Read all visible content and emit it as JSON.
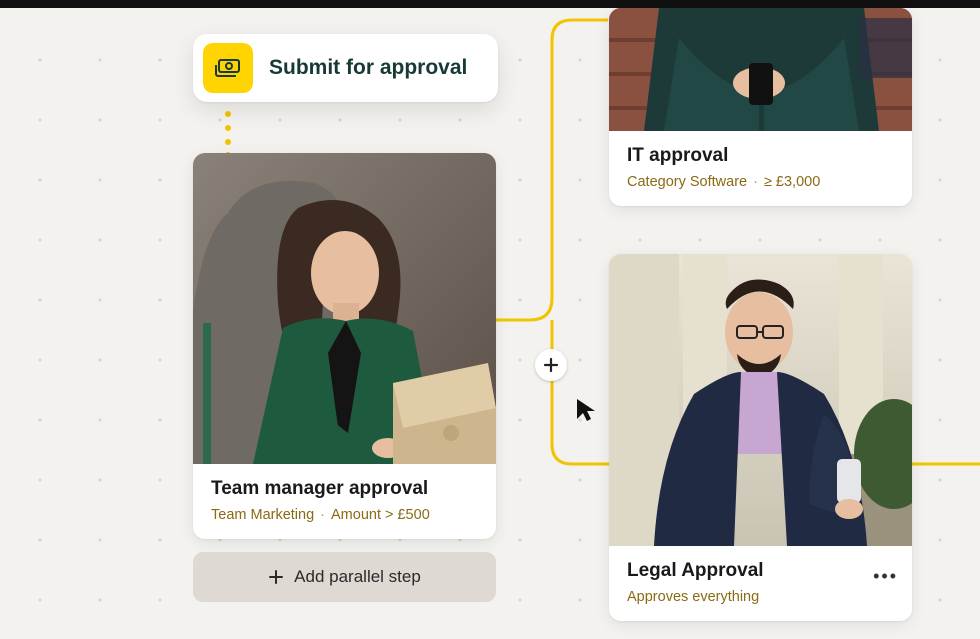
{
  "submit": {
    "label": "Submit for approval"
  },
  "cards": {
    "team": {
      "title": "Team manager approval",
      "meta1": "Team Marketing",
      "meta2": "Amount  > £500"
    },
    "it": {
      "title": "IT approval",
      "meta1": "Category Software",
      "meta2": "≥ £3,000"
    },
    "legal": {
      "title": "Legal Approval",
      "meta1": "Approves everything"
    }
  },
  "add_parallel": "Add parallel step"
}
